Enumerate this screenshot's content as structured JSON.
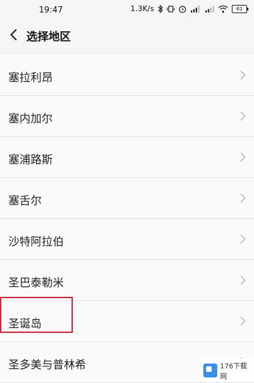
{
  "status_bar": {
    "time": "19:47",
    "speed": "1.3K/s",
    "battery": "61"
  },
  "header": {
    "title": "选择地区"
  },
  "regions": [
    {
      "label": "塞拉利昂"
    },
    {
      "label": "塞内加尔"
    },
    {
      "label": "塞浦路斯"
    },
    {
      "label": "塞舌尔"
    },
    {
      "label": "沙特阿拉伯"
    },
    {
      "label": "圣巴泰勒米"
    },
    {
      "label": "圣诞岛"
    },
    {
      "label": "圣多美与普林希"
    }
  ],
  "watermark": {
    "text": "176下载网"
  },
  "colors": {
    "highlight": "#c4303b",
    "row_bg": "#fafafa",
    "chevron": "#b0b0b0"
  }
}
